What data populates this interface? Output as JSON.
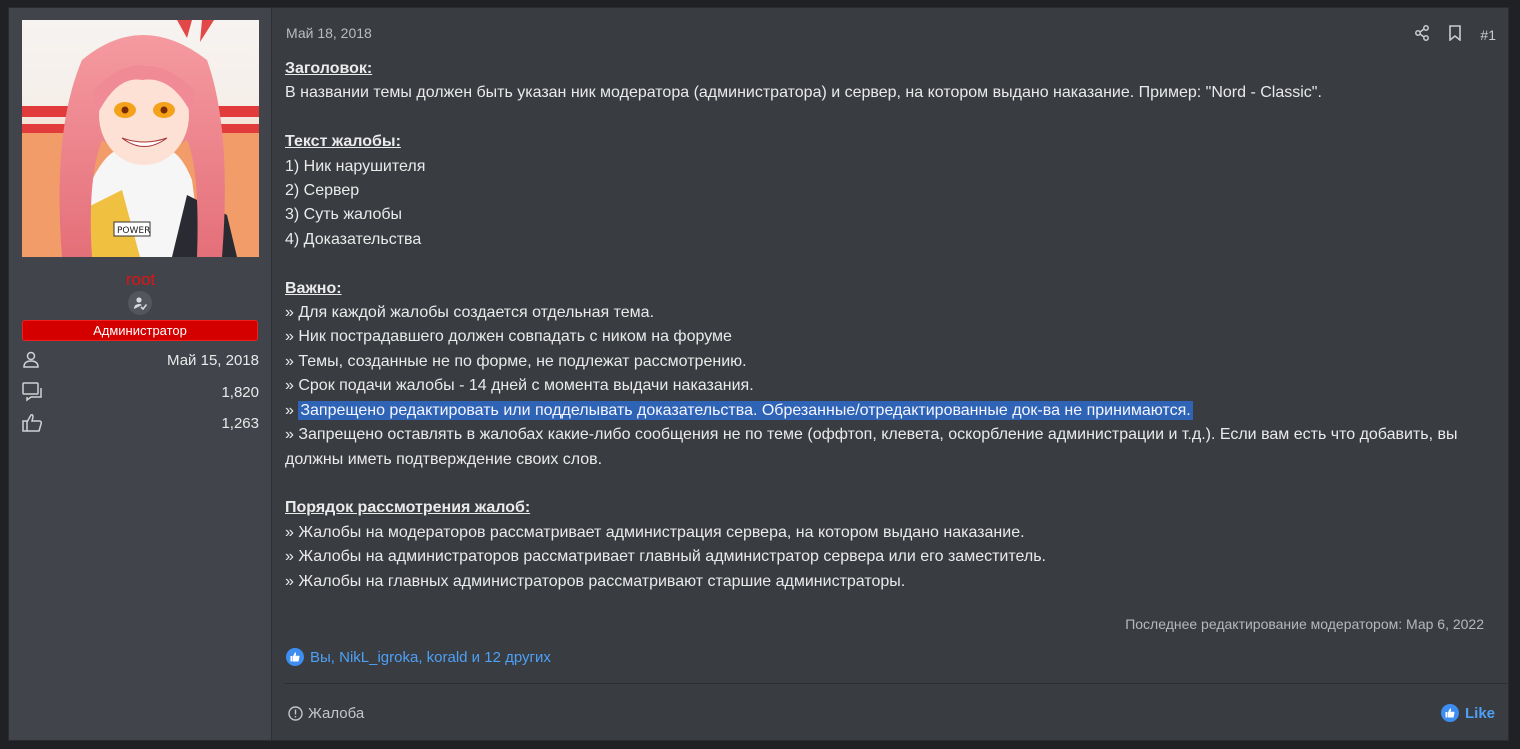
{
  "user": {
    "name": "root",
    "role": "Администратор",
    "joined": "Май 15, 2018",
    "messages": "1,820",
    "reactions": "1,263",
    "avatar_badge_text": "POWER"
  },
  "post": {
    "date": "Май 18, 2018",
    "number": "#1",
    "paragraphs": {
      "h1": "Заголовок:",
      "p1": "В названии темы должен быть указан ник модератора (администратора) и сервер, на котором выдано наказание. Пример: \"Nord - Classic\".",
      "h2": "Текст жалобы:",
      "l1": "1) Ник нарушителя",
      "l2": "2) Сервер",
      "l3": "3) Суть жалобы",
      "l4": "4) Доказательства",
      "h3": "Важно:",
      "v1": "» Для каждой жалобы создается отдельная тема.",
      "v2": "» Ник пострадавшего должен совпадать с ником на форуме",
      "v3": "» Темы, созданные не по форме, не подлежат рассмотрению.",
      "v4": "» Срок подачи жалобы - 14 дней с момента выдачи наказания.",
      "v5_prefix": "» ",
      "v5_selected": "Запрещено редактировать или подделывать доказательства. Обрезанные/отредактированные док-ва не принимаются.",
      "v6": "» Запрещено оставлять в жалобах какие-либо сообщения не по теме (оффтоп, клевета, оскорбление администрации и т.д.). Если вам есть что добавить, вы должны иметь подтверждение своих слов.",
      "h4": "Порядок рассмотрения жалоб:",
      "o1": "» Жалобы на модераторов рассматривает администрация сервера, на котором выдано наказание.",
      "o2": "» Жалобы на администраторов рассматривает главный администратор сервера или его заместитель.",
      "o3": "» Жалобы на главных администраторов рассматривают старшие администраторы."
    },
    "last_edit": "Последнее редактирование модератором: Мар 6, 2022",
    "reactions_text": "Вы, NikL_igroka, korald и 12 других",
    "report_label": "Жалоба",
    "like_label": "Like"
  },
  "colors": {
    "username": "#e31212",
    "role_bg": "#d40000",
    "link": "#4ea0f5",
    "selection": "#2f63b6"
  }
}
